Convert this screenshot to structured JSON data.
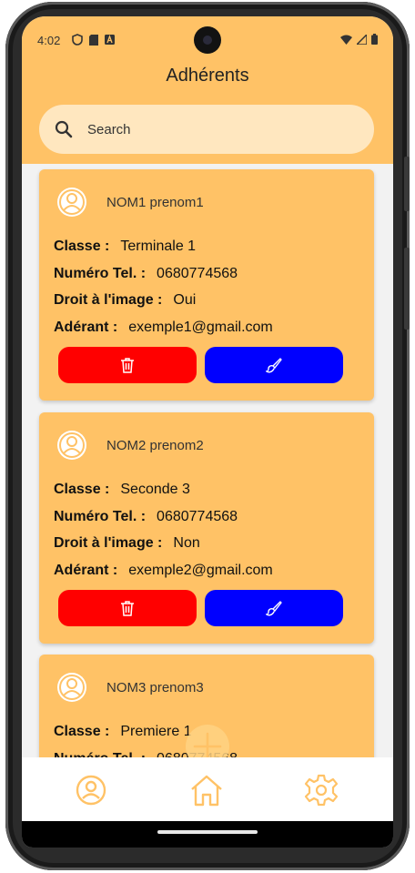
{
  "status": {
    "time": "4:02"
  },
  "header": {
    "title": "Adhérents"
  },
  "search": {
    "placeholder": "Search"
  },
  "labels": {
    "classe": "Classe :",
    "tel": "Numéro Tel. :",
    "droit": "Droit à l'image :",
    "adherant": "Adérant :"
  },
  "members": [
    {
      "name": "NOM1 prenom1",
      "classe": "Terminale 1",
      "tel": "0680774568",
      "droit": "Oui",
      "email": "exemple1@gmail.com"
    },
    {
      "name": "NOM2 prenom2",
      "classe": "Seconde 3",
      "tel": "0680774568",
      "droit": "Non",
      "email": "exemple2@gmail.com"
    },
    {
      "name": "NOM3 prenom3",
      "classe": "Premiere 1",
      "tel": "0680774568",
      "droit": "",
      "email": ""
    }
  ],
  "colors": {
    "accent": "#ffc266",
    "delete": "#ff0000",
    "edit": "#0000ff",
    "icon": "#ffc266"
  },
  "icons": {
    "search": "search-icon",
    "delete": "trash-icon",
    "edit": "brush-icon",
    "avatar": "user-circle-icon",
    "home": "home-icon",
    "settings": "gear-icon",
    "add": "plus-icon"
  }
}
